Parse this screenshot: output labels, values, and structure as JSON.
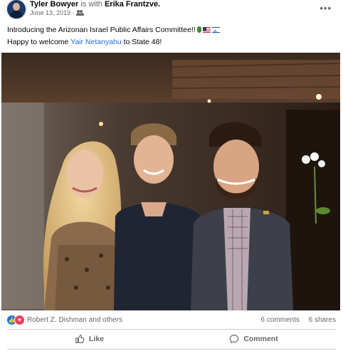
{
  "post": {
    "author": "Tyler Bowyer",
    "with_text": "is with",
    "tagged": "Erika Frantzve.",
    "date": "June 13, 2019",
    "audience_icon": "friends-icon",
    "more_icon": "more-options-icon",
    "line1": "Introducing the Arizonan Israel Public Affairs Committee!!",
    "line1_emojis": [
      "cactus",
      "us-flag",
      "israel-flag"
    ],
    "line2_prefix": "Happy to welcome ",
    "line2_link": "Yair Netanyahu",
    "line2_suffix": " to State 48!"
  },
  "reactions": {
    "icons": [
      "like-icon",
      "love-icon"
    ],
    "text": "Robert Z. Dishman and others",
    "comments": "6 comments",
    "shares": "6 shares"
  },
  "actions": {
    "like": "Like",
    "comment": "Comment"
  },
  "colors": {
    "link": "#216fdb",
    "like_blue": "#1877f2",
    "love_red": "#f33e58",
    "secondary_text": "#65676b"
  }
}
